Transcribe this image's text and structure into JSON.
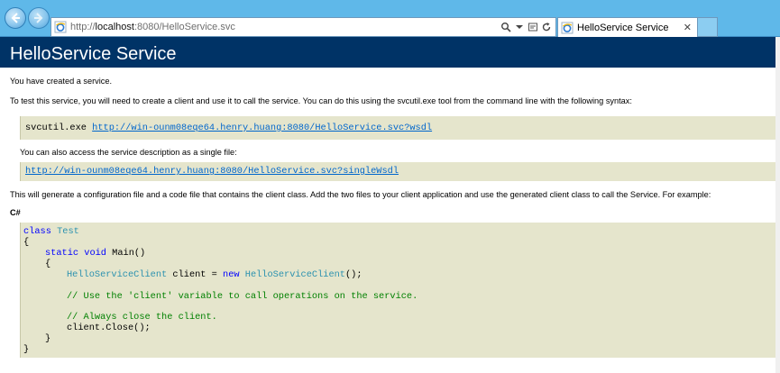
{
  "browser": {
    "url_prefix": "http://",
    "url_host": "localhost",
    "url_rest": ":8080/HelloService.svc",
    "tab_title": "HelloService Service",
    "tab_close": "✕"
  },
  "page": {
    "title": "HelloService Service",
    "intro": "You have created a service.",
    "instructions": "To test this service, you will need to create a client and use it to call the service. You can do this using the svcutil.exe tool from the command line with the following syntax:",
    "svcutil_cmd": "svcutil.exe ",
    "wsdl_link": "http://win-ounm08eqe64.henry.huang:8080/HelloService.svc?wsdl",
    "single_file_text": "You can also access the service description as a single file:",
    "single_wsdl_link": "http://win-ounm08eqe64.henry.huang:8080/HelloService.svc?singleWsdl",
    "generate_text": "This will generate a configuration file and a code file that contains the client class. Add the two files to your client application and use the generated client class to call the Service. For example:",
    "lang_heading": "C#",
    "code": {
      "kw_class": "class",
      "class_name": "Test",
      "open_brace": "{",
      "kw_static": "static",
      "kw_void": "void",
      "main_sig": " Main()",
      "method_open": "{",
      "client_type": "HelloServiceClient",
      "client_decl": " client = ",
      "kw_new": "new",
      "client_ctor": "HelloServiceClient",
      "ctor_tail": "();",
      "comment_use": "// Use the 'client' variable to call operations on the service.",
      "comment_close": "// Always close the client.",
      "close_call": "client.Close();",
      "method_close": "}",
      "close_brace": "}"
    }
  }
}
